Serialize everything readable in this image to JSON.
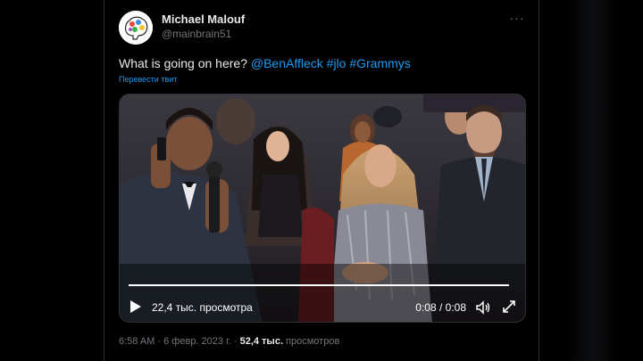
{
  "author": {
    "name": "Michael Malouf",
    "handle": "@mainbrain51",
    "avatar_icon": "brain-avatar-icon"
  },
  "more_icon": "more-dots-icon",
  "tweet": {
    "text_plain": "What is going on here?",
    "mention": "@BenAffleck",
    "hashtag1": "#jlo",
    "hashtag2": "#Grammys",
    "translate_label": "Перевести твит"
  },
  "video": {
    "views_label": "22,4 тыс. просмотра",
    "time_label": "0:08 / 0:08",
    "progress": 1.0,
    "play_icon": "play-icon",
    "volume_icon": "volume-icon",
    "fullscreen_icon": "fullscreen-icon"
  },
  "meta": {
    "timestamp": "6:58 AM · 6 февр. 2023 г. · ",
    "view_count": "52,4 тыс.",
    "views_word": " просмотров"
  },
  "colors": {
    "background": "#000000",
    "text": "#e7e9ea",
    "secondary": "#71767b",
    "link": "#1d9bf0",
    "border": "#2f3336"
  }
}
